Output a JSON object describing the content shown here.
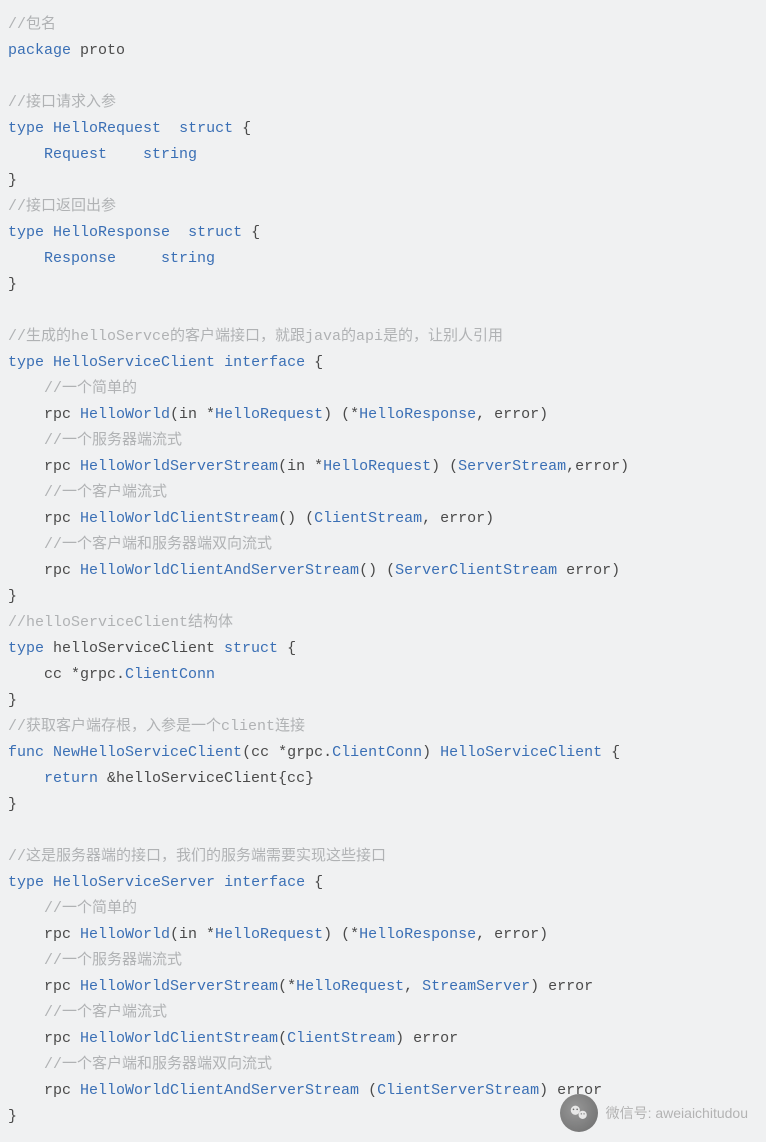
{
  "lines": [
    {
      "segs": [
        {
          "cls": "cmt",
          "t": "//包名"
        }
      ]
    },
    {
      "segs": [
        {
          "cls": "kw",
          "t": "package"
        },
        {
          "cls": "pl",
          "t": " proto"
        }
      ]
    },
    {
      "segs": []
    },
    {
      "segs": [
        {
          "cls": "cmt",
          "t": "//接口请求入参"
        }
      ]
    },
    {
      "segs": [
        {
          "cls": "kw",
          "t": "type"
        },
        {
          "cls": "pl",
          "t": " "
        },
        {
          "cls": "id",
          "t": "HelloRequest"
        },
        {
          "cls": "pl",
          "t": "  "
        },
        {
          "cls": "kw",
          "t": "struct"
        },
        {
          "cls": "pl",
          "t": " {"
        }
      ]
    },
    {
      "segs": [
        {
          "cls": "pl",
          "t": "    "
        },
        {
          "cls": "id",
          "t": "Request"
        },
        {
          "cls": "pl",
          "t": "    "
        },
        {
          "cls": "kw",
          "t": "string"
        }
      ]
    },
    {
      "segs": [
        {
          "cls": "pl",
          "t": "}"
        }
      ]
    },
    {
      "segs": [
        {
          "cls": "cmt",
          "t": "//接口返回出参"
        }
      ]
    },
    {
      "segs": [
        {
          "cls": "kw",
          "t": "type"
        },
        {
          "cls": "pl",
          "t": " "
        },
        {
          "cls": "id",
          "t": "HelloResponse"
        },
        {
          "cls": "pl",
          "t": "  "
        },
        {
          "cls": "kw",
          "t": "struct"
        },
        {
          "cls": "pl",
          "t": " {"
        }
      ]
    },
    {
      "segs": [
        {
          "cls": "pl",
          "t": "    "
        },
        {
          "cls": "id",
          "t": "Response"
        },
        {
          "cls": "pl",
          "t": "     "
        },
        {
          "cls": "kw",
          "t": "string"
        }
      ]
    },
    {
      "segs": [
        {
          "cls": "pl",
          "t": "}"
        }
      ]
    },
    {
      "segs": []
    },
    {
      "segs": [
        {
          "cls": "cmt",
          "t": "//生成的helloServce的客户端接口，就跟java的api是的，让别人引用"
        }
      ]
    },
    {
      "segs": [
        {
          "cls": "kw",
          "t": "type"
        },
        {
          "cls": "pl",
          "t": " "
        },
        {
          "cls": "id",
          "t": "HelloServiceClient"
        },
        {
          "cls": "pl",
          "t": " "
        },
        {
          "cls": "kw",
          "t": "interface"
        },
        {
          "cls": "pl",
          "t": " {"
        }
      ]
    },
    {
      "segs": [
        {
          "cls": "pl",
          "t": "    "
        },
        {
          "cls": "cmt",
          "t": "//一个简单的"
        }
      ]
    },
    {
      "segs": [
        {
          "cls": "pl",
          "t": "    rpc "
        },
        {
          "cls": "id",
          "t": "HelloWorld"
        },
        {
          "cls": "pl",
          "t": "(in *"
        },
        {
          "cls": "id",
          "t": "HelloRequest"
        },
        {
          "cls": "pl",
          "t": ") (*"
        },
        {
          "cls": "id",
          "t": "HelloResponse"
        },
        {
          "cls": "pl",
          "t": ", error)"
        }
      ]
    },
    {
      "segs": [
        {
          "cls": "pl",
          "t": "    "
        },
        {
          "cls": "cmt",
          "t": "//一个服务器端流式"
        }
      ]
    },
    {
      "segs": [
        {
          "cls": "pl",
          "t": "    rpc "
        },
        {
          "cls": "id",
          "t": "HelloWorldServerStream"
        },
        {
          "cls": "pl",
          "t": "(in *"
        },
        {
          "cls": "id",
          "t": "HelloRequest"
        },
        {
          "cls": "pl",
          "t": ") ("
        },
        {
          "cls": "id",
          "t": "ServerStream"
        },
        {
          "cls": "pl",
          "t": ",error)"
        }
      ]
    },
    {
      "segs": [
        {
          "cls": "pl",
          "t": "    "
        },
        {
          "cls": "cmt",
          "t": "//一个客户端流式"
        }
      ]
    },
    {
      "segs": [
        {
          "cls": "pl",
          "t": "    rpc "
        },
        {
          "cls": "id",
          "t": "HelloWorldClientStream"
        },
        {
          "cls": "pl",
          "t": "() ("
        },
        {
          "cls": "id",
          "t": "ClientStream"
        },
        {
          "cls": "pl",
          "t": ", error)"
        }
      ]
    },
    {
      "segs": [
        {
          "cls": "pl",
          "t": "    "
        },
        {
          "cls": "cmt",
          "t": "//一个客户端和服务器端双向流式"
        }
      ]
    },
    {
      "segs": [
        {
          "cls": "pl",
          "t": "    rpc "
        },
        {
          "cls": "id",
          "t": "HelloWorldClientAndServerStream"
        },
        {
          "cls": "pl",
          "t": "() ("
        },
        {
          "cls": "id",
          "t": "ServerClientStream"
        },
        {
          "cls": "pl",
          "t": " error)"
        }
      ]
    },
    {
      "segs": [
        {
          "cls": "pl",
          "t": "}"
        }
      ]
    },
    {
      "segs": [
        {
          "cls": "cmt",
          "t": "//helloServiceClient结构体"
        }
      ]
    },
    {
      "segs": [
        {
          "cls": "kw",
          "t": "type"
        },
        {
          "cls": "pl",
          "t": " helloServiceClient "
        },
        {
          "cls": "kw",
          "t": "struct"
        },
        {
          "cls": "pl",
          "t": " {"
        }
      ]
    },
    {
      "segs": [
        {
          "cls": "pl",
          "t": "    cc *grpc."
        },
        {
          "cls": "id",
          "t": "ClientConn"
        }
      ]
    },
    {
      "segs": [
        {
          "cls": "pl",
          "t": "}"
        }
      ]
    },
    {
      "segs": [
        {
          "cls": "cmt",
          "t": "//获取客户端存根，入参是一个client连接"
        }
      ]
    },
    {
      "segs": [
        {
          "cls": "kw",
          "t": "func"
        },
        {
          "cls": "pl",
          "t": " "
        },
        {
          "cls": "id",
          "t": "NewHelloServiceClient"
        },
        {
          "cls": "pl",
          "t": "(cc *grpc."
        },
        {
          "cls": "id",
          "t": "ClientConn"
        },
        {
          "cls": "pl",
          "t": ") "
        },
        {
          "cls": "id",
          "t": "HelloServiceClient"
        },
        {
          "cls": "pl",
          "t": " {"
        }
      ]
    },
    {
      "segs": [
        {
          "cls": "pl",
          "t": "    "
        },
        {
          "cls": "kw",
          "t": "return"
        },
        {
          "cls": "pl",
          "t": " &helloServiceClient{cc}"
        }
      ]
    },
    {
      "segs": [
        {
          "cls": "pl",
          "t": "}"
        }
      ]
    },
    {
      "segs": []
    },
    {
      "segs": [
        {
          "cls": "cmt",
          "t": "//这是服务器端的接口，我们的服务端需要实现这些接口"
        }
      ]
    },
    {
      "segs": [
        {
          "cls": "kw",
          "t": "type"
        },
        {
          "cls": "pl",
          "t": " "
        },
        {
          "cls": "id",
          "t": "HelloServiceServer"
        },
        {
          "cls": "pl",
          "t": " "
        },
        {
          "cls": "kw",
          "t": "interface"
        },
        {
          "cls": "pl",
          "t": " {"
        }
      ]
    },
    {
      "segs": [
        {
          "cls": "pl",
          "t": "    "
        },
        {
          "cls": "cmt",
          "t": "//一个简单的"
        }
      ]
    },
    {
      "segs": [
        {
          "cls": "pl",
          "t": "    rpc "
        },
        {
          "cls": "id",
          "t": "HelloWorld"
        },
        {
          "cls": "pl",
          "t": "(in *"
        },
        {
          "cls": "id",
          "t": "HelloRequest"
        },
        {
          "cls": "pl",
          "t": ") (*"
        },
        {
          "cls": "id",
          "t": "HelloResponse"
        },
        {
          "cls": "pl",
          "t": ", error)"
        }
      ]
    },
    {
      "segs": [
        {
          "cls": "pl",
          "t": "    "
        },
        {
          "cls": "cmt",
          "t": "//一个服务器端流式"
        }
      ]
    },
    {
      "segs": [
        {
          "cls": "pl",
          "t": "    rpc "
        },
        {
          "cls": "id",
          "t": "HelloWorldServerStream"
        },
        {
          "cls": "pl",
          "t": "(*"
        },
        {
          "cls": "id",
          "t": "HelloRequest"
        },
        {
          "cls": "pl",
          "t": ", "
        },
        {
          "cls": "id",
          "t": "StreamServer"
        },
        {
          "cls": "pl",
          "t": ") error"
        }
      ]
    },
    {
      "segs": [
        {
          "cls": "pl",
          "t": "    "
        },
        {
          "cls": "cmt",
          "t": "//一个客户端流式"
        }
      ]
    },
    {
      "segs": [
        {
          "cls": "pl",
          "t": "    rpc "
        },
        {
          "cls": "id",
          "t": "HelloWorldClientStream"
        },
        {
          "cls": "pl",
          "t": "("
        },
        {
          "cls": "id",
          "t": "ClientStream"
        },
        {
          "cls": "pl",
          "t": ") error"
        }
      ]
    },
    {
      "segs": [
        {
          "cls": "pl",
          "t": "    "
        },
        {
          "cls": "cmt",
          "t": "//一个客户端和服务器端双向流式"
        }
      ]
    },
    {
      "segs": [
        {
          "cls": "pl",
          "t": "    rpc "
        },
        {
          "cls": "id",
          "t": "HelloWorldClientAndServerStream"
        },
        {
          "cls": "pl",
          "t": " ("
        },
        {
          "cls": "id",
          "t": "ClientServerStream"
        },
        {
          "cls": "pl",
          "t": ") error"
        }
      ]
    },
    {
      "segs": [
        {
          "cls": "pl",
          "t": "}"
        }
      ]
    }
  ],
  "watermark": {
    "label": "微信号: aweiaichitudou"
  }
}
